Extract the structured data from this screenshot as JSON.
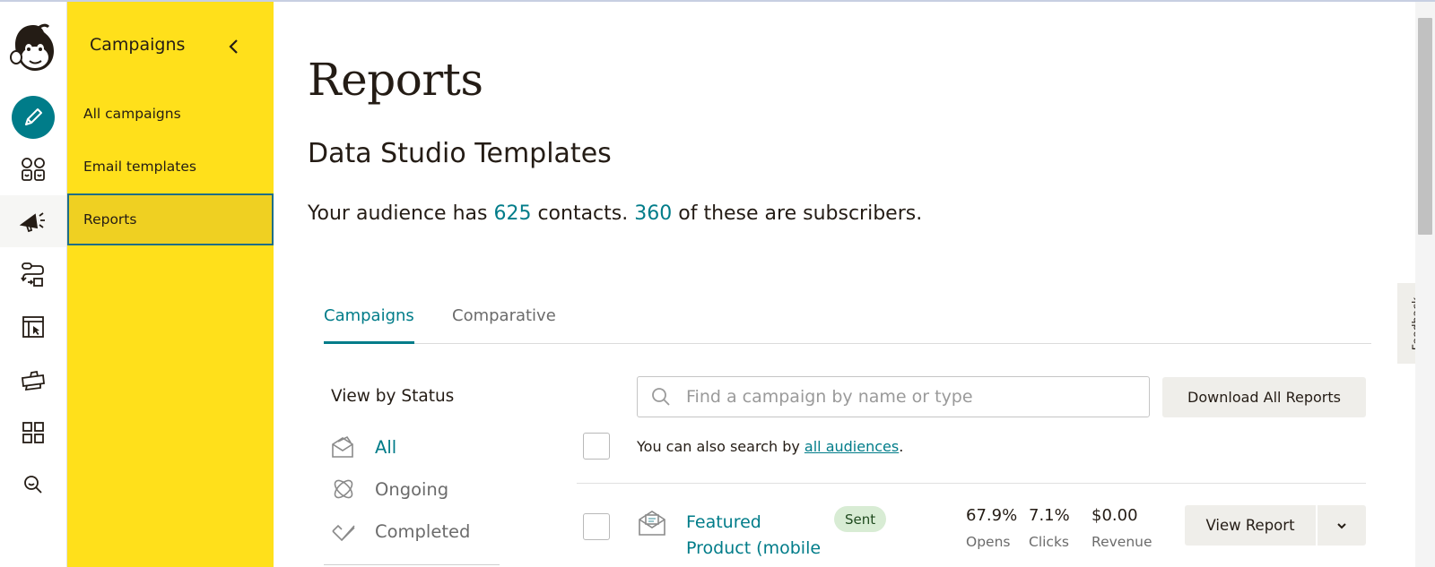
{
  "rail": {
    "icons": [
      "freddie-logo-icon",
      "pencil-icon",
      "audience-icon",
      "megaphone-icon",
      "automation-icon",
      "website-icon",
      "content-icon",
      "integrations-icon",
      "search-icon"
    ]
  },
  "nav": {
    "title": "Campaigns",
    "items": [
      {
        "label": "All campaigns"
      },
      {
        "label": "Email templates"
      },
      {
        "label": "Reports"
      }
    ]
  },
  "page": {
    "title": "Reports",
    "section_title": "Data Studio Templates",
    "audience": {
      "prefix": "Your audience has",
      "contacts": "625",
      "middle": "contacts.",
      "subscribers": "360",
      "suffix": "of these are subscribers."
    }
  },
  "tabs": [
    {
      "label": "Campaigns",
      "active": true
    },
    {
      "label": "Comparative",
      "active": false
    }
  ],
  "status": {
    "heading": "View by Status",
    "items": [
      {
        "label": "All",
        "active": true
      },
      {
        "label": "Ongoing",
        "active": false
      },
      {
        "label": "Completed",
        "active": false
      }
    ]
  },
  "search": {
    "placeholder": "Find a campaign by name or type",
    "value": ""
  },
  "download_label": "Download All Reports",
  "hint": {
    "prefix": "You can also search by",
    "link": "all audiences",
    "suffix": "."
  },
  "campaigns": [
    {
      "title": "Featured Product (mobile",
      "status": "Sent",
      "opens": "67.9%",
      "opens_label": "Opens",
      "clicks": "7.1%",
      "clicks_label": "Clicks",
      "revenue": "$0.00",
      "revenue_label": "Revenue",
      "view_label": "View Report"
    }
  ],
  "feedback_label": "Feedback",
  "colors": {
    "accent": "#007c89",
    "nav_yellow": "#ffe01b",
    "sent_badge": "#d8ecd4"
  }
}
